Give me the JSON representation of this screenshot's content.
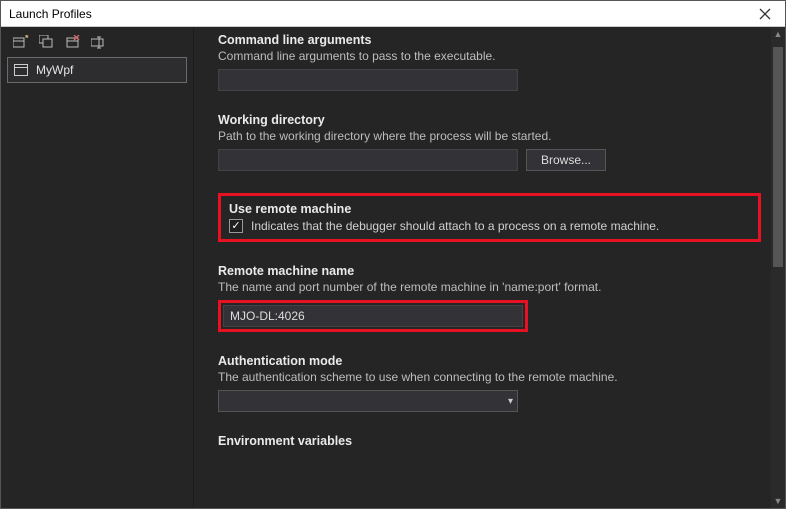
{
  "window": {
    "title": "Launch Profiles"
  },
  "sidebar": {
    "profile_name": "MyWpf"
  },
  "sections": {
    "cmd": {
      "title": "Command line arguments",
      "desc": "Command line arguments to pass to the executable.",
      "value": ""
    },
    "workdir": {
      "title": "Working directory",
      "desc": "Path to the working directory where the process will be started.",
      "value": "",
      "browse_label": "Browse..."
    },
    "remote": {
      "title": "Use remote machine",
      "checkbox_label": "Indicates that the debugger should attach to a process on a remote machine."
    },
    "remote_name": {
      "title": "Remote machine name",
      "desc": "The name and port number of the remote machine in 'name:port' format.",
      "value": "MJO-DL:4026"
    },
    "auth": {
      "title": "Authentication mode",
      "desc": "The authentication scheme to use when connecting to the remote machine.",
      "value": ""
    },
    "env": {
      "title": "Environment variables"
    }
  }
}
